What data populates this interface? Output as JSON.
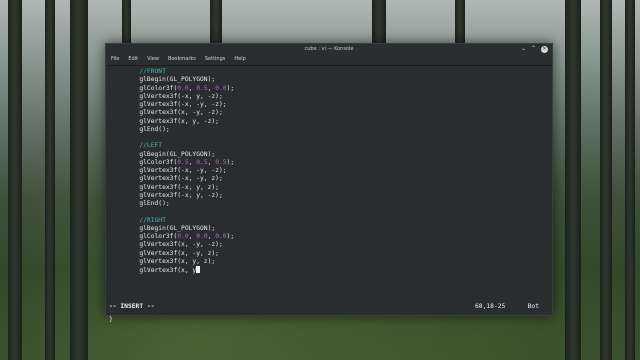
{
  "window": {
    "title": "cube : vi — Konsole",
    "controls": {
      "minimize": "⌄",
      "maximize": "⌃",
      "close": "✕"
    }
  },
  "menu": [
    "File",
    "Edit",
    "View",
    "Bookmarks",
    "Settings",
    "Help"
  ],
  "code": [
    {
      "indent": "    ",
      "segments": [
        {
          "t": "//FRONT",
          "c": "comment"
        }
      ]
    },
    {
      "indent": "    ",
      "segments": [
        {
          "t": "glBegin(GL_POLYGON);",
          "c": ""
        }
      ]
    },
    {
      "indent": "    ",
      "segments": [
        {
          "t": "glColor3f(",
          "c": ""
        },
        {
          "t": "0.0",
          "c": "num"
        },
        {
          "t": ", ",
          "c": ""
        },
        {
          "t": "0.5",
          "c": "num"
        },
        {
          "t": ", ",
          "c": ""
        },
        {
          "t": "0.0",
          "c": "num"
        },
        {
          "t": ");",
          "c": ""
        }
      ]
    },
    {
      "indent": "    ",
      "segments": [
        {
          "t": "glVertex3f(-x, y, -z);",
          "c": ""
        }
      ]
    },
    {
      "indent": "    ",
      "segments": [
        {
          "t": "glVertex3f(-x, -y, -z);",
          "c": ""
        }
      ]
    },
    {
      "indent": "    ",
      "segments": [
        {
          "t": "glVertex3f(x, -y, -z);",
          "c": ""
        }
      ]
    },
    {
      "indent": "    ",
      "segments": [
        {
          "t": "glVertex3f(x, y, -z);",
          "c": ""
        }
      ]
    },
    {
      "indent": "    ",
      "segments": [
        {
          "t": "glEnd();",
          "c": ""
        }
      ]
    },
    {
      "indent": "",
      "segments": []
    },
    {
      "indent": "    ",
      "segments": [
        {
          "t": "//LEFT",
          "c": "comment"
        }
      ]
    },
    {
      "indent": "    ",
      "segments": [
        {
          "t": "glBegin(GL_POLYGON);",
          "c": ""
        }
      ]
    },
    {
      "indent": "    ",
      "segments": [
        {
          "t": "glColor3f(",
          "c": ""
        },
        {
          "t": "0.5",
          "c": "num"
        },
        {
          "t": ", ",
          "c": ""
        },
        {
          "t": "0.5",
          "c": "num"
        },
        {
          "t": ", ",
          "c": ""
        },
        {
          "t": "0.5",
          "c": "num"
        },
        {
          "t": ");",
          "c": ""
        }
      ]
    },
    {
      "indent": "    ",
      "segments": [
        {
          "t": "glVertex3f(-x, -y, -z);",
          "c": ""
        }
      ]
    },
    {
      "indent": "    ",
      "segments": [
        {
          "t": "glVertex3f(-x, -y, z);",
          "c": ""
        }
      ]
    },
    {
      "indent": "    ",
      "segments": [
        {
          "t": "glVertex3f(-x, y, z);",
          "c": ""
        }
      ]
    },
    {
      "indent": "    ",
      "segments": [
        {
          "t": "glVertex3f(-x, y, -z);",
          "c": ""
        }
      ]
    },
    {
      "indent": "    ",
      "segments": [
        {
          "t": "glEnd();",
          "c": ""
        }
      ]
    },
    {
      "indent": "",
      "segments": []
    },
    {
      "indent": "    ",
      "segments": [
        {
          "t": "//RIGHT",
          "c": "comment"
        }
      ]
    },
    {
      "indent": "    ",
      "segments": [
        {
          "t": "glBegin(GL_POLYGON);",
          "c": ""
        }
      ]
    },
    {
      "indent": "    ",
      "segments": [
        {
          "t": "glColor3f(",
          "c": ""
        },
        {
          "t": "0.0",
          "c": "num"
        },
        {
          "t": ", ",
          "c": ""
        },
        {
          "t": "0.0",
          "c": "num"
        },
        {
          "t": ", ",
          "c": ""
        },
        {
          "t": "0.0",
          "c": "num"
        },
        {
          "t": ");",
          "c": ""
        }
      ]
    },
    {
      "indent": "    ",
      "segments": [
        {
          "t": "glVertex3f(x, -y, -z);",
          "c": ""
        }
      ]
    },
    {
      "indent": "    ",
      "segments": [
        {
          "t": "glVertex3f(x, -y, z);",
          "c": ""
        }
      ]
    },
    {
      "indent": "    ",
      "segments": [
        {
          "t": "glVertex3f(x, y, z);",
          "c": ""
        }
      ]
    },
    {
      "indent": "    ",
      "segments": [
        {
          "t": "glVertex3f(x, y",
          "c": ""
        }
      ],
      "cursor": true
    }
  ],
  "closing_brace": "}",
  "status": {
    "mode": "-- INSERT --",
    "position": "68,18-25",
    "scroll": "Bot"
  },
  "colors": {
    "comment": "#3fb8b0",
    "number": "#b266cc",
    "editor_bg": "#2a2d2f",
    "titlebar_bg": "#2b2e31"
  }
}
